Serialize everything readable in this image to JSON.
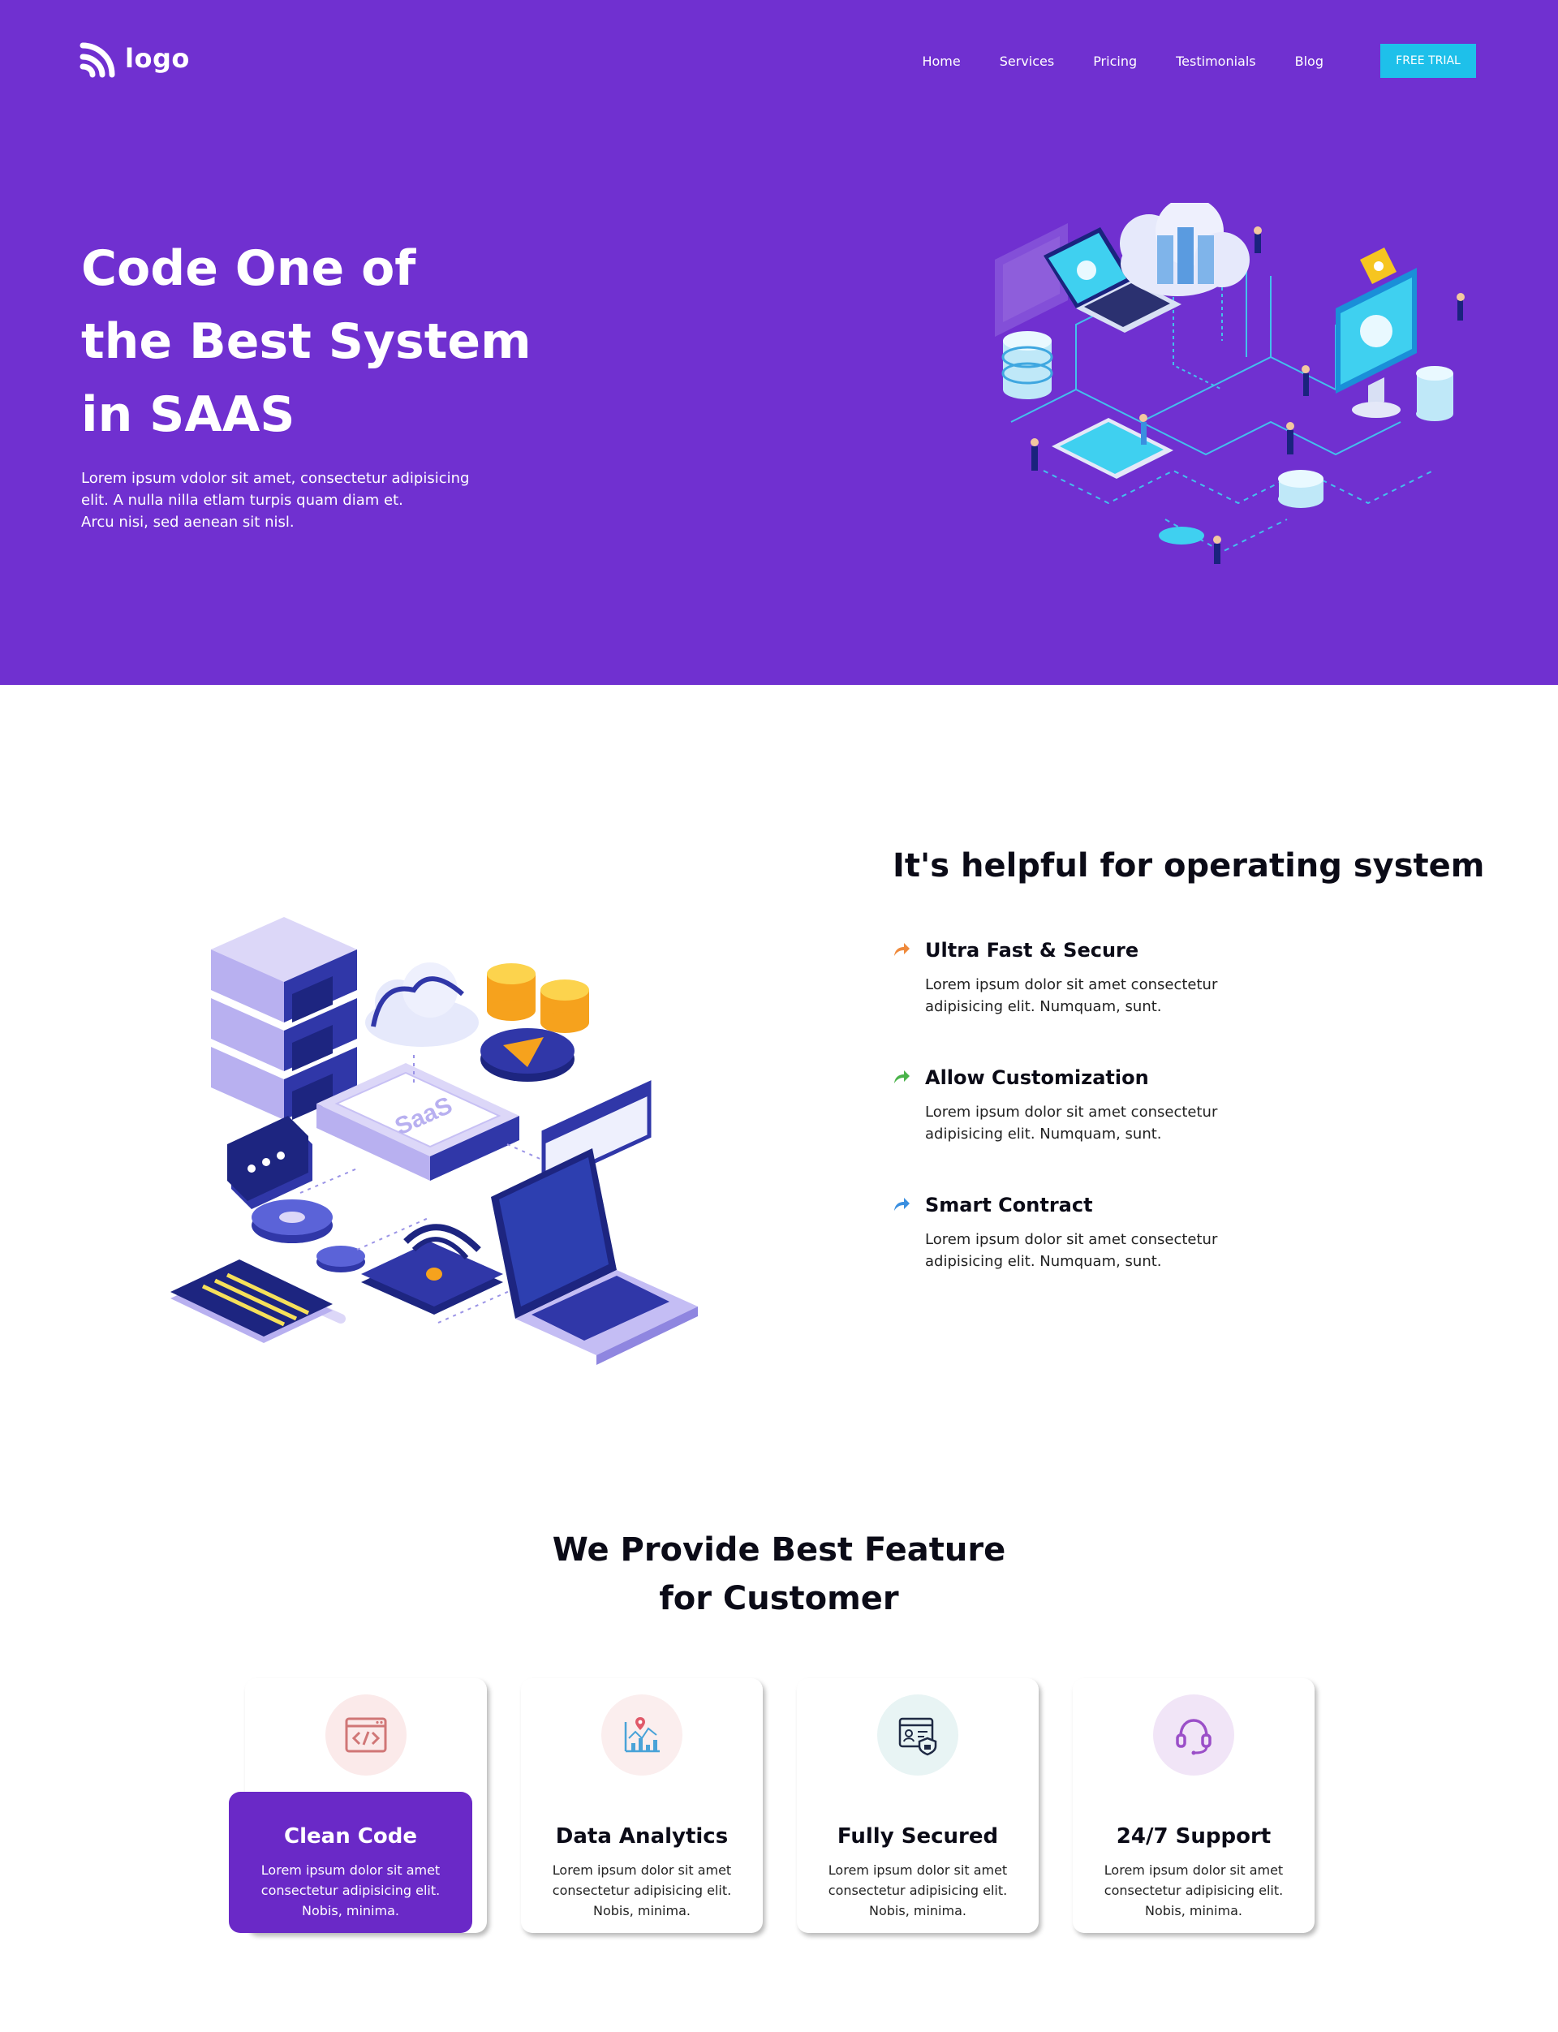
{
  "header": {
    "logo_text": "logo",
    "nav": [
      "Home",
      "Services",
      "Pricing",
      "Testimonials",
      "Blog"
    ],
    "cta": "FREE TRIAL"
  },
  "hero": {
    "title_lines": [
      "Code One of",
      "the Best System",
      "in SAAS"
    ],
    "description_lines": [
      "Lorem ipsum vdolor sit amet, consectetur adipisicing",
      "elit. A nulla nilla etlam turpis quam diam et.",
      "Arcu nisi, sed aenean sit nisl."
    ]
  },
  "about": {
    "title": "It's helpful for operating system",
    "illustration_label": "SaaS",
    "features": [
      {
        "title": "Ultra Fast & Secure",
        "icon": "share-arrow-icon",
        "color": "#ef8a3c",
        "text_lines": [
          "Lorem ipsum dolor sit amet consectetur",
          "adipisicing elit. Numquam, sunt."
        ]
      },
      {
        "title": "Allow Customization",
        "icon": "share-arrow-icon",
        "color": "#4ab34a",
        "text_lines": [
          "Lorem ipsum dolor sit amet consectetur",
          "adipisicing elit. Numquam, sunt."
        ]
      },
      {
        "title": "Smart Contract",
        "icon": "share-arrow-icon",
        "color": "#3a8fe0",
        "text_lines": [
          "Lorem ipsum dolor sit amet consectetur",
          "adipisicing elit. Numquam, sunt."
        ]
      }
    ]
  },
  "services": {
    "title_lines": [
      "We Provide Best Feature",
      "for Customer"
    ],
    "cards": [
      {
        "title": "Clean Code",
        "icon": "code-window-icon",
        "icon_bg": "#fbeaea",
        "active": true,
        "text_lines": [
          "Lorem ipsum dolor sit amet",
          "consectetur adipisicing elit.",
          "Nobis, minima."
        ]
      },
      {
        "title": "Data Analytics",
        "icon": "chart-pin-icon",
        "icon_bg": "#fbeeee",
        "active": false,
        "text_lines": [
          "Lorem ipsum dolor sit amet",
          "consectetur adipisicing elit.",
          "Nobis, minima."
        ]
      },
      {
        "title": "Fully Secured",
        "icon": "secure-id-icon",
        "icon_bg": "#e8f4f4",
        "active": false,
        "text_lines": [
          "Lorem ipsum dolor sit amet",
          "consectetur adipisicing elit.",
          "Nobis, minima."
        ]
      },
      {
        "title": "24/7 Support",
        "icon": "headset-icon",
        "icon_bg": "#f1e5f7",
        "active": false,
        "text_lines": [
          "Lorem ipsum dolor sit amet",
          "consectetur adipisicing elit.",
          "Nobis, minima."
        ]
      }
    ]
  },
  "colors": {
    "brand": "#7030d0",
    "accent": "#1ec0ea",
    "card_active": "#6a29c7"
  }
}
